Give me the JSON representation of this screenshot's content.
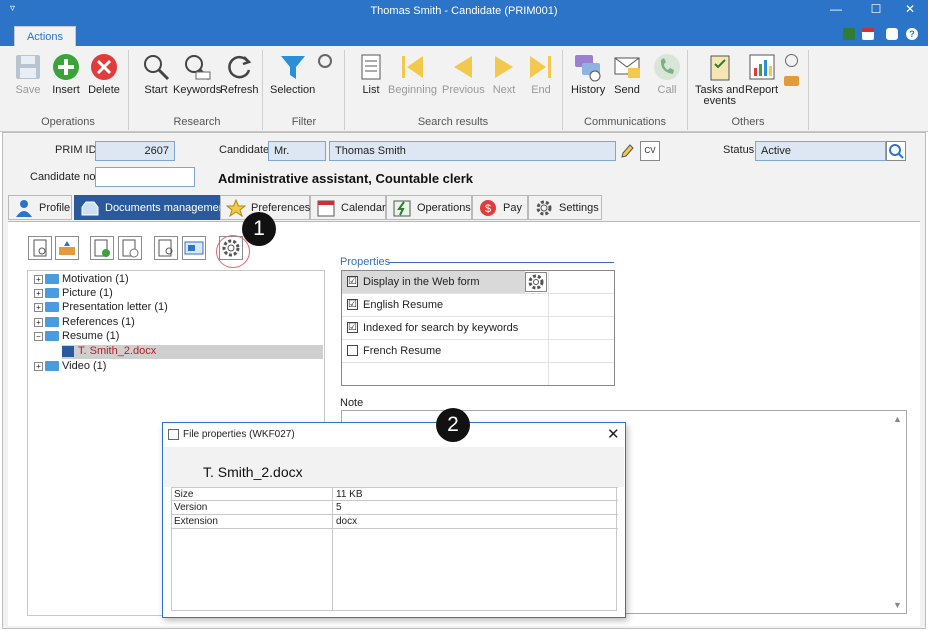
{
  "window": {
    "title": "Thomas Smith - Candidate (PRIM001)",
    "controls": {
      "minimize": "—",
      "maximize": "☐",
      "close": "✕"
    }
  },
  "ribbon_tab": "Actions",
  "ribbon": {
    "operations": {
      "save": "Save",
      "insert": "Insert",
      "delete": "Delete",
      "group": "Operations"
    },
    "research": {
      "start": "Start",
      "keywords": "Keywords",
      "refresh": "Refresh",
      "group": "Research"
    },
    "filter": {
      "selection": "Selection",
      "group": "Filter"
    },
    "search_results": {
      "list": "List",
      "beginning": "Beginning",
      "previous": "Previous",
      "next": "Next",
      "end": "End",
      "group": "Search results"
    },
    "communications": {
      "history": "History",
      "send": "Send",
      "call": "Call",
      "group": "Communications"
    },
    "others": {
      "tasks_line1": "Tasks and",
      "tasks_line2": "events",
      "report": "Report",
      "group": "Others"
    }
  },
  "form": {
    "prim_id_label": "PRIM ID",
    "prim_id_value": "2607",
    "candidate_label": "Candidate",
    "candidate_title": "Mr.",
    "candidate_name": "Thomas Smith",
    "candidate_no_label": "Candidate no.",
    "candidate_no_value": "",
    "status_label": "Status",
    "status_value": "Active",
    "headline": "Administrative assistant, Countable clerk"
  },
  "tabs": {
    "profile": "Profile",
    "documents": "Documents management",
    "preferences": "Preferences",
    "calendar": "Calendar",
    "operations": "Operations",
    "pay": "Pay",
    "settings": "Settings"
  },
  "tree": [
    {
      "label": "Motivation (1)"
    },
    {
      "label": "Picture (1)"
    },
    {
      "label": "Presentation letter (1)"
    },
    {
      "label": "References (1)"
    },
    {
      "label": "Resume (1)"
    },
    {
      "label": "T. Smith_2.docx"
    },
    {
      "label": "Video (1)"
    }
  ],
  "properties": {
    "title": "Properties",
    "items": [
      {
        "label": "Display in the Web form",
        "checked": "☑"
      },
      {
        "label": "English Resume",
        "checked": "☑"
      },
      {
        "label": "Indexed for search by keywords",
        "checked": "☑"
      },
      {
        "label": "French Resume",
        "checked": ""
      }
    ]
  },
  "note_label": "Note",
  "callouts": {
    "one": "1",
    "two": "2"
  },
  "dialog": {
    "title": "File properties (WKF027)",
    "filename": "T. Smith_2.docx",
    "rows": [
      {
        "key": "Size",
        "value": "11 KB"
      },
      {
        "key": "Version",
        "value": "5"
      },
      {
        "key": "Extension",
        "value": "docx"
      }
    ]
  },
  "colors": {
    "accent": "#2b74c7",
    "active_tab": "#2b5a9c",
    "callout_ring": "#e26a6a"
  }
}
